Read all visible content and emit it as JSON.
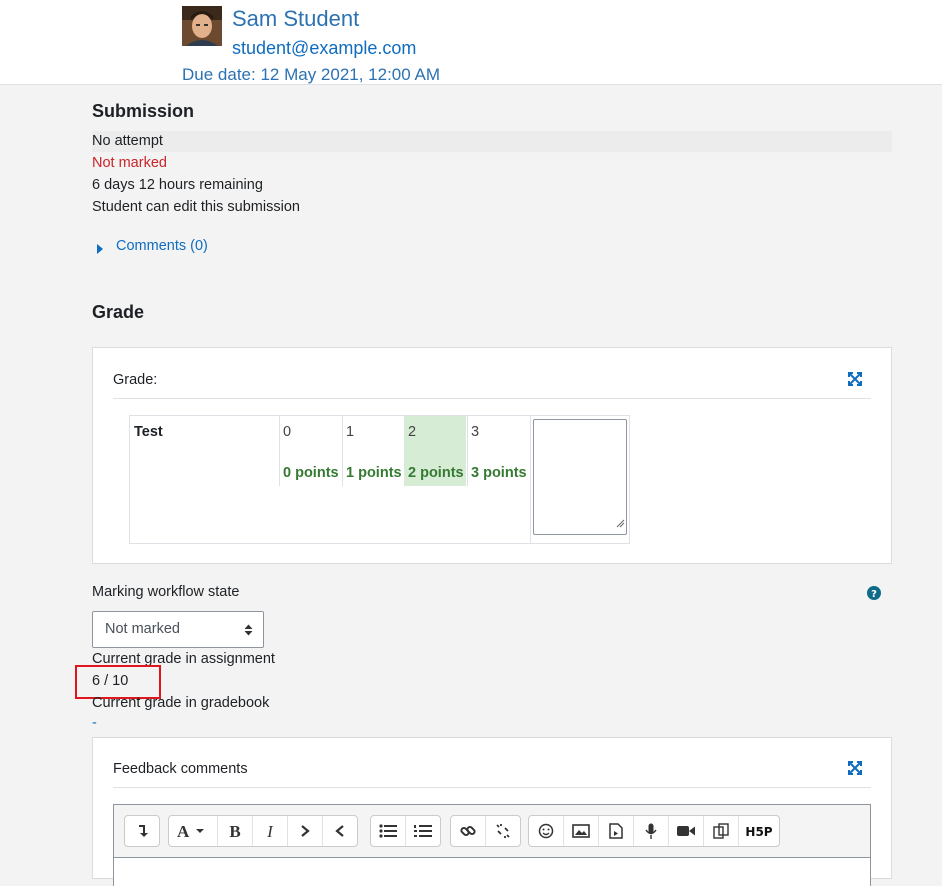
{
  "user": {
    "name": "Sam Student",
    "email": "student@example.com",
    "due_date": "Due date: 12 May 2021, 12:00 AM"
  },
  "submission": {
    "heading": "Submission",
    "status": "No attempt",
    "grading_status": "Not marked",
    "time_remaining": "6 days 12 hours remaining",
    "edit_status": "Student can edit this submission",
    "comments_link": "Comments (0)"
  },
  "grade": {
    "heading": "Grade",
    "label": "Grade:",
    "rubric": {
      "criterion": "Test",
      "levels": [
        {
          "score": "0",
          "definition": "0 points",
          "selected": false
        },
        {
          "score": "1",
          "definition": "1 points",
          "selected": false
        },
        {
          "score": "2",
          "definition": "2 points",
          "selected": true
        },
        {
          "score": "3",
          "definition": "3 points",
          "selected": false
        }
      ],
      "selected_level_color": "#d7ecd4"
    }
  },
  "workflow": {
    "label": "Marking workflow state",
    "selected": "Not marked"
  },
  "current_grade": {
    "assignment_label": "Current grade in assignment",
    "assignment_value": "6 / 10",
    "gradebook_label": "Current grade in gradebook",
    "gradebook_value": "-"
  },
  "feedback": {
    "label": "Feedback comments"
  },
  "toolbar": {
    "groups": [
      [
        "collapse-icon"
      ],
      [
        "font-style-icon",
        "bold-icon",
        "italic-icon",
        "indent-icon",
        "outdent-icon"
      ],
      [
        "bullet-list-icon",
        "numbered-list-icon"
      ],
      [
        "link-icon",
        "unlink-icon"
      ],
      [
        "emoji-icon",
        "image-icon",
        "media-icon",
        "audio-record-icon",
        "video-record-icon",
        "manage-files-icon",
        "h5p-icon"
      ]
    ]
  },
  "colors": {
    "accent": "#0f6cbf",
    "status_red": "#c9252a",
    "highlight_box": "#e0161e",
    "points_green": "#357a32"
  }
}
